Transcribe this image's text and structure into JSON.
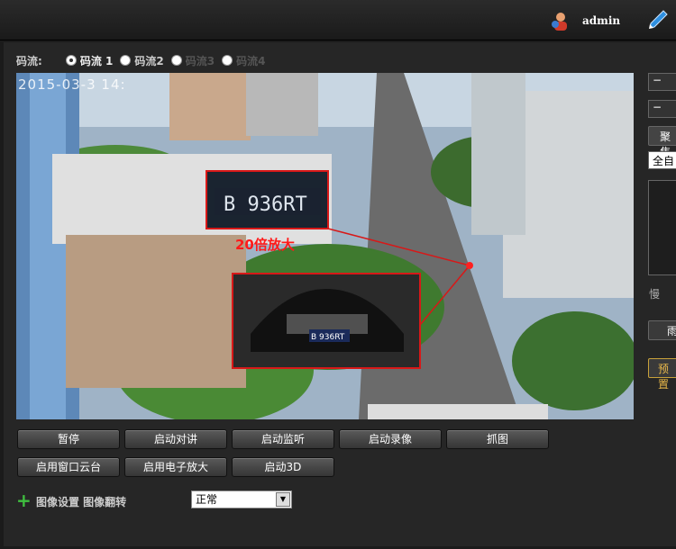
{
  "header": {
    "username": "admin",
    "user_icon": "user-icon",
    "tool_icon": "pen-icon"
  },
  "stream": {
    "label": "码流:",
    "options": [
      {
        "label": "码流 1",
        "selected": true,
        "enabled": true
      },
      {
        "label": "码流2",
        "selected": false,
        "enabled": true
      },
      {
        "label": "码流3",
        "selected": false,
        "enabled": false
      },
      {
        "label": "码流4",
        "selected": false,
        "enabled": false
      }
    ]
  },
  "video": {
    "timestamp": "2015-03-3 14:",
    "plate_text": "B 936RT",
    "car_plate": "B 936RT",
    "zoom_label": "20倍放大"
  },
  "controls": {
    "row1": [
      "暂停",
      "启动对讲",
      "启动监听",
      "启动录像",
      "抓图"
    ],
    "row2": [
      "启用窗口云台",
      "启用电子放大",
      "启动3D"
    ]
  },
  "image_settings": {
    "label": "图像设置 图像翻转",
    "flip_value": "正常"
  },
  "side_panel": {
    "focus_label": "聚焦",
    "mode_value": "全自",
    "speed_label": "慢",
    "preset_label": "预置",
    "other_button": "雨"
  },
  "colors": {
    "accent_red": "#ff1a1a",
    "plus_green": "#3fbf3f"
  }
}
